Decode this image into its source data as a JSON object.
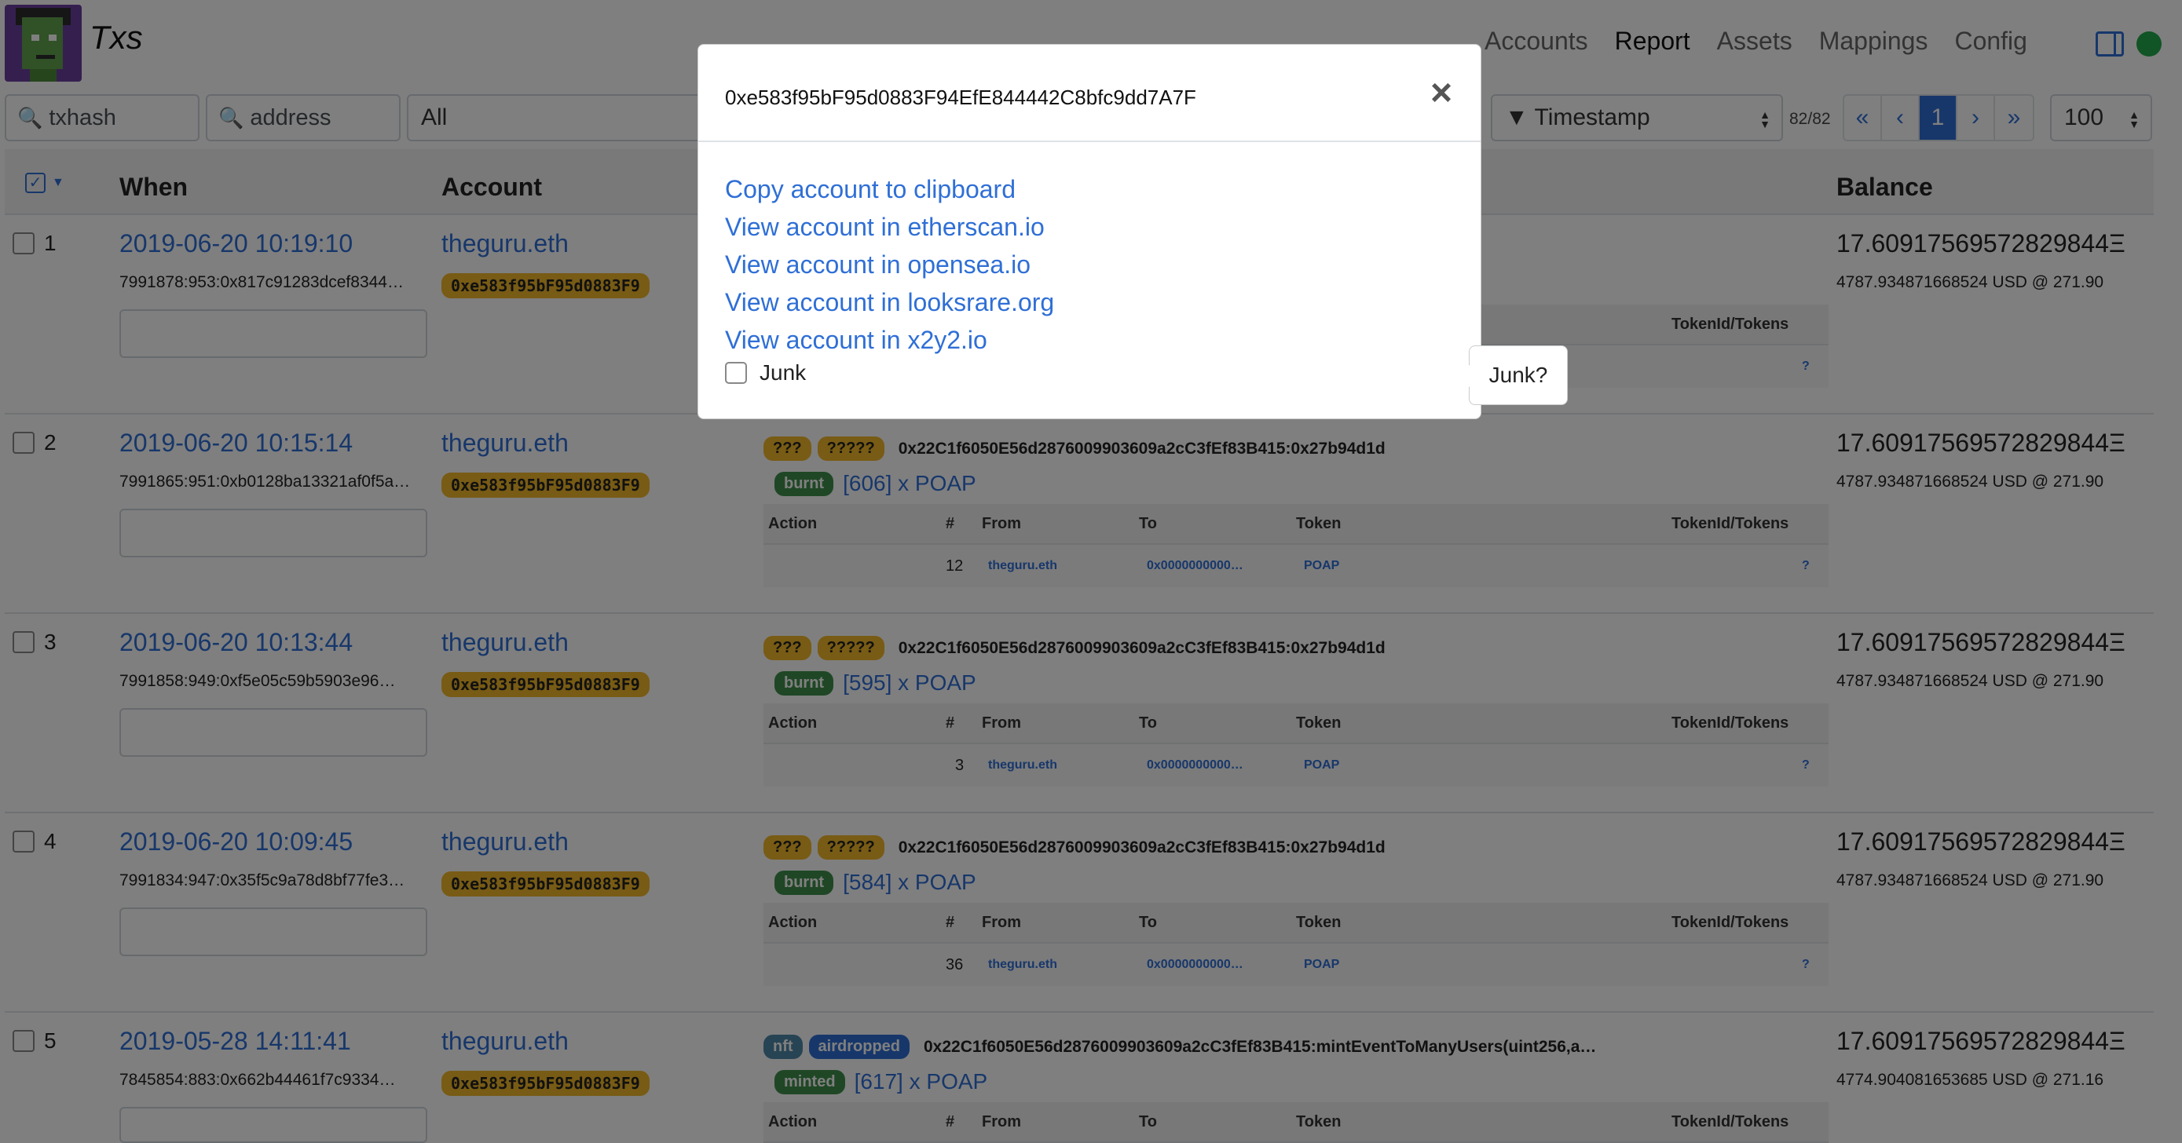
{
  "app": {
    "title": "Txs"
  },
  "nav": {
    "items": [
      "Accounts",
      "Report",
      "Assets",
      "Mappings",
      "Config"
    ],
    "active": "Report"
  },
  "filters": {
    "txhash_placeholder": "txhash",
    "address_placeholder": "address",
    "all_value": "All",
    "sort_value": "▼ Timestamp",
    "count": "82/82",
    "page_size": "100"
  },
  "pager": {
    "first": "«",
    "prev": "‹",
    "current": "1",
    "next": "›",
    "last": "»"
  },
  "table": {
    "headers": {
      "when": "When",
      "account": "Account",
      "balance": "Balance"
    }
  },
  "inner_headers": {
    "action": "Action",
    "num": "#",
    "from": "From",
    "to": "To",
    "token": "Token",
    "tokenid": "TokenId/Tokens"
  },
  "rows": [
    {
      "num": "1",
      "when": "2019-06-20 10:19:10",
      "txref": "7991878:953:0x817c91283dcef8344…",
      "account": "theguru.eth",
      "addr": "0xe583f95bF95d0883F9",
      "balance": "17.60917569572829844Ξ",
      "balance_usd": "4787.934871668524 USD @ 271.90",
      "inner_tokenid": "?"
    },
    {
      "num": "2",
      "when": "2019-06-20 10:15:14",
      "txref": "7991865:951:0xb0128ba13321af0f5a…",
      "account": "theguru.eth",
      "addr": "0xe583f95bF95d0883F9",
      "badge1": "???",
      "badge2": "?????",
      "contract": "0x22C1f6050E56d2876009903609a2cC3fEf83B415:0x27b94d1d",
      "xfer_badge": "burnt",
      "xfer": "[606] x POAP",
      "inner_num": "12",
      "inner_from": "theguru.eth",
      "inner_to": "0x0000000000…",
      "inner_token": "POAP",
      "inner_tokenid": "?",
      "balance": "17.60917569572829844Ξ",
      "balance_usd": "4787.934871668524 USD @ 271.90"
    },
    {
      "num": "3",
      "when": "2019-06-20 10:13:44",
      "txref": "7991858:949:0xf5e05c59b5903e96…",
      "account": "theguru.eth",
      "addr": "0xe583f95bF95d0883F9",
      "badge1": "???",
      "badge2": "?????",
      "contract": "0x22C1f6050E56d2876009903609a2cC3fEf83B415:0x27b94d1d",
      "xfer_badge": "burnt",
      "xfer": "[595] x POAP",
      "inner_num": "3",
      "inner_from": "theguru.eth",
      "inner_to": "0x0000000000…",
      "inner_token": "POAP",
      "inner_tokenid": "?",
      "balance": "17.60917569572829844Ξ",
      "balance_usd": "4787.934871668524 USD @ 271.90"
    },
    {
      "num": "4",
      "when": "2019-06-20 10:09:45",
      "txref": "7991834:947:0x35f5c9a78d8bf77fe3…",
      "account": "theguru.eth",
      "addr": "0xe583f95bF95d0883F9",
      "badge1": "???",
      "badge2": "?????",
      "contract": "0x22C1f6050E56d2876009903609a2cC3fEf83B415:0x27b94d1d",
      "xfer_badge": "burnt",
      "xfer": "[584] x POAP",
      "inner_num": "36",
      "inner_from": "theguru.eth",
      "inner_to": "0x0000000000…",
      "inner_token": "POAP",
      "inner_tokenid": "?",
      "balance": "17.60917569572829844Ξ",
      "balance_usd": "4787.934871668524 USD @ 271.90"
    },
    {
      "num": "5",
      "when": "2019-05-28 14:11:41",
      "txref": "7845854:883:0x662b44461f7c9334…",
      "account": "theguru.eth",
      "addr": "0xe583f95bF95d0883F9",
      "badge1": "nft",
      "badge2": "airdropped",
      "contract": "0x22C1f6050E56d2876009903609a2cC3fEf83B415:mintEventToManyUsers(uint256,a…",
      "xfer_badge": "minted",
      "xfer": "[617] x POAP",
      "balance": "17.60917569572829844Ξ",
      "balance_usd": "4774.904081653685 USD @ 271.16"
    }
  ],
  "modal": {
    "title": "0xe583f95bF95d0883F94EfE844442C8bfc9dd7A7F",
    "close": "×",
    "links": [
      "Copy account to clipboard",
      "View account in etherscan.io",
      "View account in opensea.io",
      "View account in looksrare.org",
      "View account in x2y2.io"
    ],
    "junk_label": "Junk",
    "tooltip": "Junk?"
  }
}
